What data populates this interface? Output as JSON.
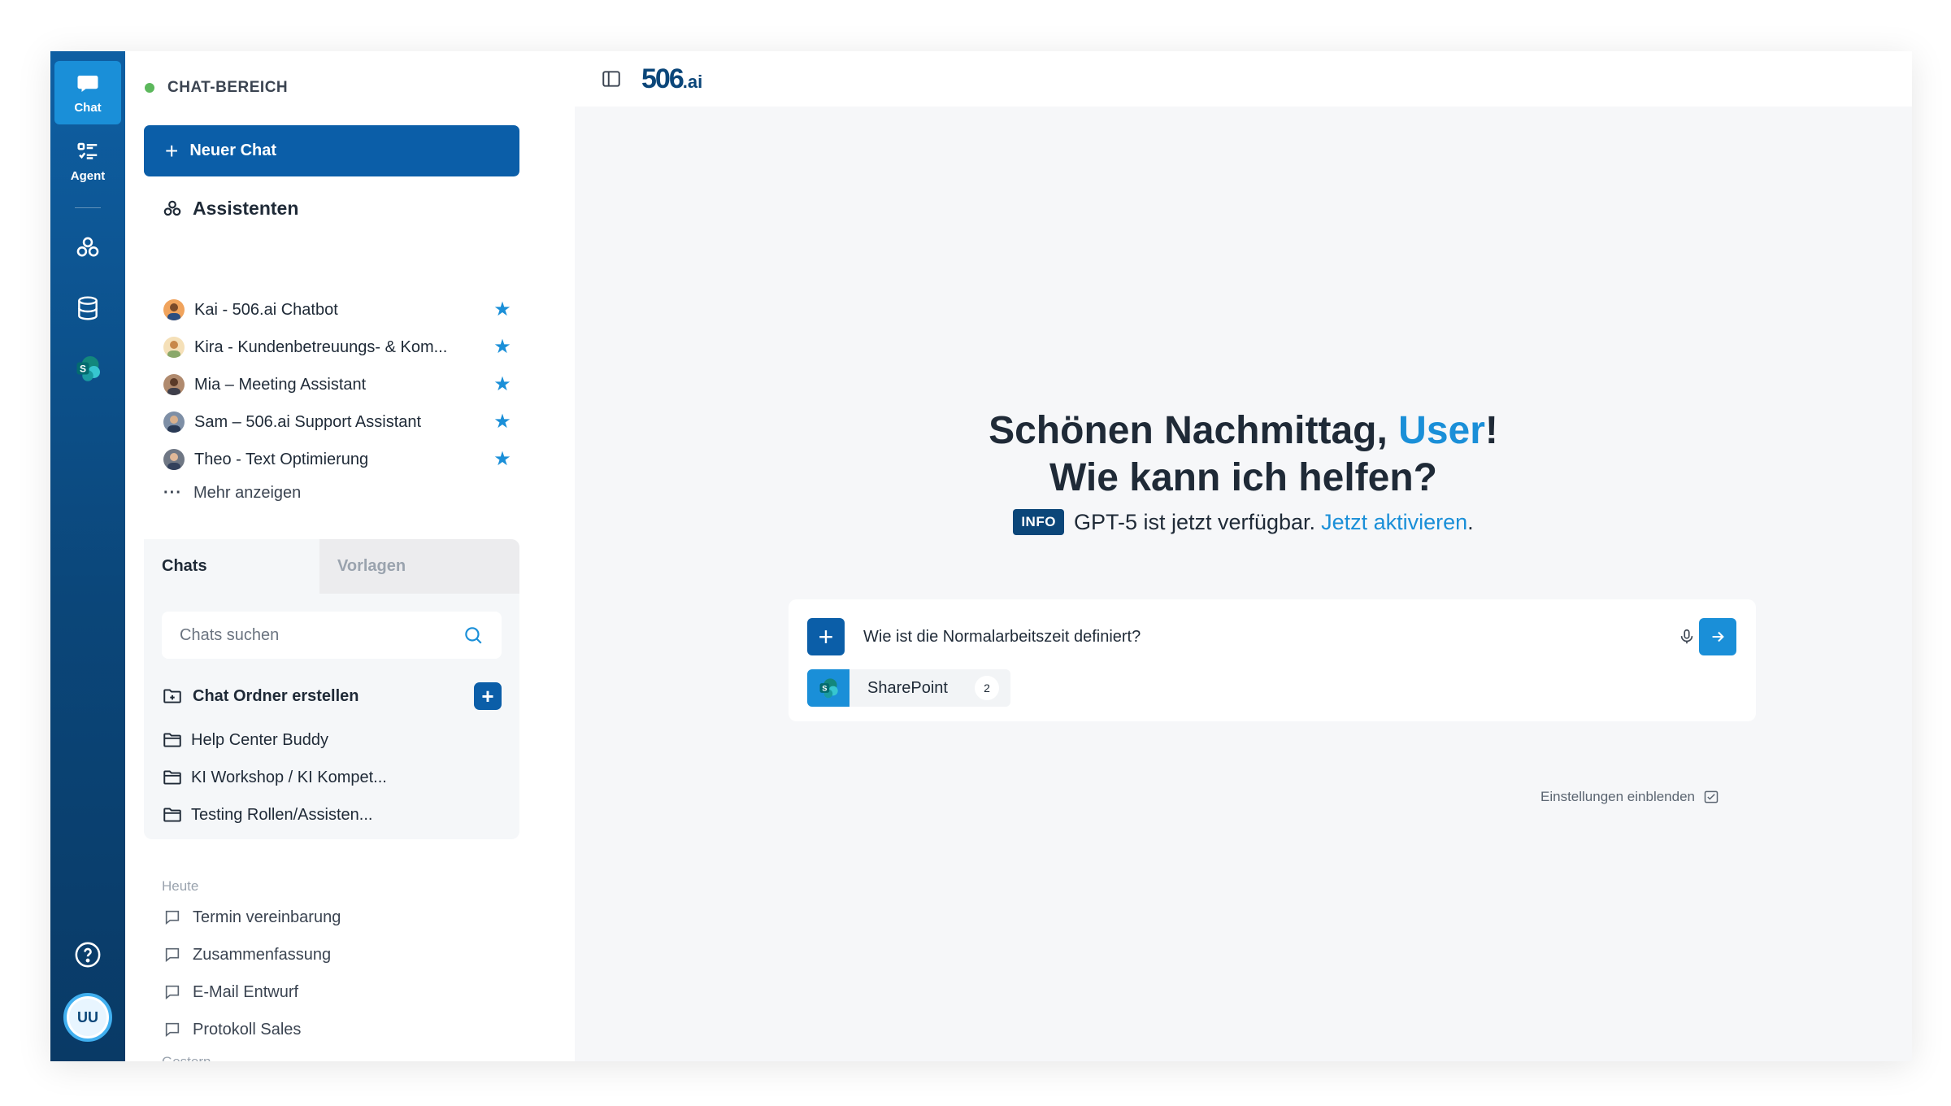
{
  "rail": {
    "chat_label": "Chat",
    "agent_label": "Agent",
    "icons": [
      "chat-icon",
      "agent-list-icon",
      "assistants-icon",
      "database-icon",
      "sharepoint-icon",
      "help-icon"
    ],
    "avatar_initials": "UU"
  },
  "sidebar": {
    "area_title": "CHAT-BEREICH",
    "new_chat_label": "Neuer Chat",
    "assistants_title": "Assistenten",
    "assistants": [
      {
        "name": "Kai - 506.ai Chatbot",
        "starred": true
      },
      {
        "name": "Kira - Kundenbetreuungs- & Kom...",
        "starred": true
      },
      {
        "name": "Mia – Meeting Assistant",
        "starred": true
      },
      {
        "name": "Sam – 506.ai Support Assistant",
        "starred": true
      },
      {
        "name": "Theo - Text Optimierung",
        "starred": true
      }
    ],
    "more_label": "Mehr anzeigen",
    "tabs": [
      "Chats",
      "Vorlagen"
    ],
    "search_placeholder": "Chats suchen",
    "folder_create_label": "Chat Ordner erstellen",
    "folders": [
      "Help Center Buddy",
      "KI Workshop / KI Kompet...",
      "Testing Rollen/Assisten..."
    ],
    "today_label": "Heute",
    "today_chats": [
      "Termin vereinbarung",
      "Zusammenfassung",
      "E-Mail Entwurf",
      "Protokoll Sales"
    ],
    "yesterday_label": "Gestern"
  },
  "header": {
    "logo_text": "506",
    "logo_suffix": ".ai"
  },
  "main": {
    "greeting_prefix": "Schönen Nachmittag, ",
    "greeting_user": "User",
    "greeting_suffix": "!",
    "greeting_line2": "Wie kann ich helfen?",
    "info_badge": "INFO",
    "info_text": "GPT-5 ist jetzt verfügbar.",
    "info_link": "Jetzt aktivieren",
    "info_end": ".",
    "input_value": "Wie ist die Normalarbeitszeit definiert?",
    "source_chip": {
      "label": "SharePoint",
      "count": "2"
    },
    "settings_label": "Einstellungen einblenden"
  },
  "colors": {
    "brand": "#0b5ea8",
    "accent": "#1a8fd8",
    "rail_dark": "#0b4679",
    "status_online": "#5cb85c"
  }
}
